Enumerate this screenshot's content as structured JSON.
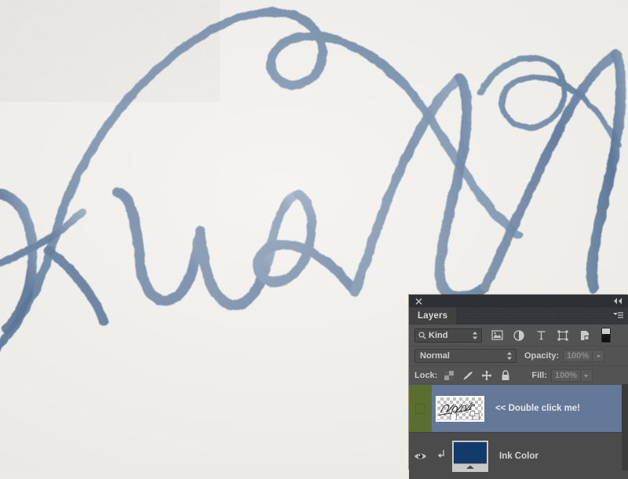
{
  "application": {
    "document_title": "watercolor-lettering-canvas",
    "artwork_description": "Blue watercolor brush calligraphy on textured paper"
  },
  "artwork": {
    "paper_color": "#edebe6",
    "ink_color": "#5d7897",
    "ink_color_dark": "#44618a",
    "visible_letters": "kwell"
  },
  "panel": {
    "close_icon": "close-icon",
    "collapse_icon": "double-arrow-collapse-icon",
    "menu_icon": "panel-menu-icon",
    "tabs": [
      {
        "label": "Layers",
        "active": true
      }
    ]
  },
  "filter_bar": {
    "kind_label": "Kind",
    "search_icon": "search-icon",
    "stepper_icon": "up-down-stepper-icon",
    "icons": [
      {
        "name": "filter-pixel-layers-icon",
        "title": "Pixel layers"
      },
      {
        "name": "filter-adjustment-layers-icon",
        "title": "Adjustment layers"
      },
      {
        "name": "filter-type-layers-icon",
        "title": "Type layers"
      },
      {
        "name": "filter-shape-layers-icon",
        "title": "Shape layers"
      },
      {
        "name": "filter-smart-object-icon",
        "title": "Smart objects"
      }
    ],
    "toggle_name": "filter-enable-toggle"
  },
  "blend_bar": {
    "blend_mode": "Normal",
    "opacity_label": "Opacity:",
    "opacity_value": "100%"
  },
  "lock_bar": {
    "lock_label": "Lock:",
    "fill_label": "Fill:",
    "fill_value": "100%",
    "locks": [
      {
        "name": "lock-transparent-pixels-icon"
      },
      {
        "name": "lock-image-pixels-icon"
      },
      {
        "name": "lock-position-icon"
      },
      {
        "name": "lock-all-icon"
      }
    ]
  },
  "layers": [
    {
      "name": "<< Double click me!",
      "selected": true,
      "visible": true,
      "visibility_highlight_color": "#5a6e30",
      "row_color": "#64799a",
      "thumbnail": "transparent-lettering-thumbnail",
      "clipped": false
    },
    {
      "name": "Ink Color",
      "selected": false,
      "visible": true,
      "row_color": "#4b4b4b",
      "thumbnail": "solid-fill-thumbnail",
      "thumbnail_color": "#123a6b",
      "clipped": true,
      "clip_icon": "clipping-mask-arrow-icon",
      "eye_icon": "eye-visibility-icon"
    }
  ]
}
